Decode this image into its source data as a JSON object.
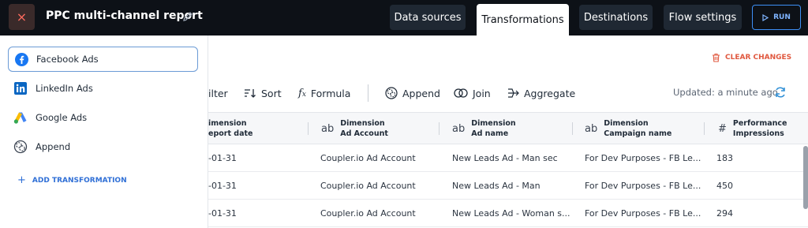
{
  "header": {
    "title": "PPC multi-channel report",
    "tabs": [
      {
        "label": "Data sources"
      },
      {
        "label": "Transformations"
      },
      {
        "label": "Destinations"
      },
      {
        "label": "Flow settings"
      }
    ],
    "run_label": "RUN",
    "close_glyph": "×"
  },
  "sidebar": {
    "items": [
      {
        "label": "Facebook Ads",
        "icon": "facebook-icon"
      },
      {
        "label": "LinkedIn Ads",
        "icon": "linkedin-icon"
      },
      {
        "label": "Google Ads",
        "icon": "google-ads-icon"
      },
      {
        "label": "Append",
        "icon": "append-icon"
      }
    ],
    "add_label": "ADD TRANSFORMATION",
    "add_glyph": "+"
  },
  "toolbar": {
    "clear_changes": "CLEAR CHANGES",
    "filter": "ilter",
    "sort": "Sort",
    "formula": "Formula",
    "append": "Append",
    "join": "Join",
    "aggregate": "Aggregate",
    "updated": "Updated: a minute ago"
  },
  "table": {
    "columns": [
      {
        "type": "",
        "line1": "imension",
        "line2": "eport date"
      },
      {
        "type": "ab",
        "line1": "Dimension",
        "line2": "Ad Account"
      },
      {
        "type": "ab",
        "line1": "Dimension",
        "line2": "Ad name"
      },
      {
        "type": "ab",
        "line1": "Dimension",
        "line2": "Campaign name"
      },
      {
        "type": "#",
        "line1": "Performance",
        "line2": "Impressions"
      }
    ],
    "rows": [
      [
        "-01-31",
        "Coupler.io Ad Account",
        "New Leads Ad - Man sec",
        "For Dev Purposes - FB Le...",
        "183"
      ],
      [
        "-01-31",
        "Coupler.io Ad Account",
        "New Leads Ad - Man",
        "For Dev Purposes - FB Le...",
        "450"
      ],
      [
        "-01-31",
        "Coupler.io Ad Account",
        "New Leads Ad - Woman s...",
        "For Dev Purposes - FB Le...",
        "294"
      ]
    ]
  },
  "colors": {
    "topbar": "#0d1117",
    "accent": "#2f6fd6",
    "danger": "#e0583f",
    "facebook": "#1877f2",
    "linkedin": "#0a66c2"
  }
}
